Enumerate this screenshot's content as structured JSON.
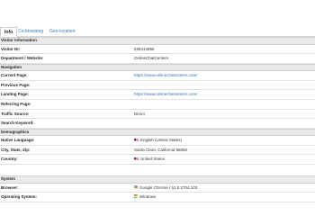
{
  "tabs": [
    {
      "label": "Info",
      "active": true
    },
    {
      "label": "Co-browsing",
      "active": false
    },
    {
      "label": "Geo-location",
      "active": false
    }
  ],
  "visitor_information": {
    "heading": "Visitor Information",
    "visitor_id_label": "Visitor ID:",
    "visitor_id_value": "535414856",
    "department_label": "Department / Website:",
    "department_value": "OnlineChatCenters"
  },
  "navigation": {
    "heading": "Navigation",
    "current_page_label": "Current Page:",
    "current_page_value": "https://www.onlinechatcenters.com/",
    "previous_page_label": "Previous Page:",
    "previous_page_value": "",
    "landing_page_label": "Landing Page:",
    "landing_page_value": "https://www.onlinechatcenters.com/",
    "referring_page_label": "Referring Page:",
    "referring_page_value": "",
    "traffic_source_label": "Traffic Source:",
    "traffic_source_value": "Direct",
    "search_keyword_label": "Search Keyword:",
    "search_keyword_value": ""
  },
  "demographics": {
    "heading": "Demographics",
    "native_language_label": "Native Language:",
    "native_language_value": "English (United States)",
    "city_label": "City, State, Zip:",
    "city_value": "Santa Clara, California 95050",
    "country_label": "Country:",
    "country_value": "United States"
  },
  "system": {
    "heading": "System",
    "browser_label": "Browser:",
    "browser_value": "Google Chrome / 51.0.2704.103",
    "os_label": "Operating System:",
    "os_value": "Windows"
  },
  "icons": {
    "flag": "us-flag-icon",
    "browser": "chrome-icon",
    "os": "windows-icon"
  }
}
